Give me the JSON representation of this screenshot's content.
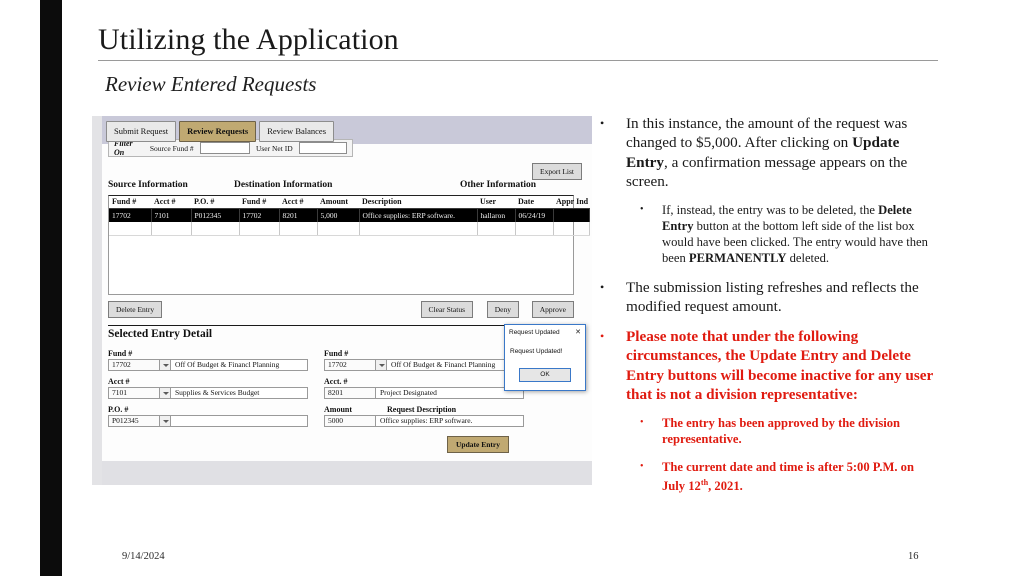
{
  "slide": {
    "title": "Utilizing the Application",
    "subtitle": "Review Entered Requests",
    "footer_date": "9/14/2024",
    "page_number": "16",
    "accent_color": "#c0a972",
    "alert_color": "#e01b10"
  },
  "app": {
    "tabs": [
      {
        "label": "Submit Request",
        "active": false
      },
      {
        "label": "Review Requests",
        "active": true
      },
      {
        "label": "Review Balances",
        "active": false
      }
    ],
    "filter": {
      "label": "Filter On",
      "source_fund_label": "Source Fund #",
      "source_fund_value": "",
      "user_net_id_label": "User Net ID",
      "user_net_id_value": ""
    },
    "export_button": "Export List",
    "section_headers": {
      "source": "Source Information",
      "destination": "Destination Information",
      "other": "Other Information"
    },
    "grid": {
      "columns": [
        "Fund #",
        "Acct #",
        "P.O. #",
        "Fund #",
        "Acct #",
        "Amount",
        "Description",
        "User",
        "Date",
        "Appr Ind"
      ],
      "rows": [
        [
          "17702",
          "7101",
          "P012345",
          "17702",
          "8201",
          "5,000",
          "Office supplies: ERP software.",
          "hallaron",
          "06/24/19",
          ""
        ]
      ],
      "blank_rows": 1
    },
    "list_buttons": {
      "delete": "Delete Entry",
      "clear_status": "Clear Status",
      "deny": "Deny",
      "approve": "Approve"
    },
    "detail": {
      "title": "Selected Entry Detail",
      "source": {
        "fund_label": "Fund #",
        "fund_code": "17702",
        "fund_name": "Off Of Budget & Financl Planning",
        "acct_label": "Acct #",
        "acct_code": "7101",
        "acct_name": "Supplies & Services Budget",
        "po_label": "P.O. #",
        "po_code": "P012345",
        "po_name": ""
      },
      "destination": {
        "fund_label": "Fund #",
        "fund_code": "17702",
        "fund_name": "Off Of Budget & Financl Planning",
        "acct_label": "Acct. #",
        "acct_code": "8201",
        "acct_name": "Project Designated",
        "amount_label": "Amount",
        "amount_value": "5000",
        "description_label": "Request Description",
        "description_value": "Office supplies: ERP software."
      },
      "update_button": "Update Entry"
    },
    "dialog": {
      "title": "Request Updated",
      "close_icon": "close-icon",
      "message": "Request Updated!",
      "ok_button": "OK"
    }
  },
  "bullets": [
    {
      "level": 1,
      "color": "black",
      "parts": [
        {
          "text": "In this instance, the amount of the request was changed to $5,000. After clicking on ",
          "bold": false
        },
        {
          "text": "Update Entry",
          "bold": true
        },
        {
          "text": ", a confirmation message appears on the screen.",
          "bold": false
        }
      ]
    },
    {
      "level": 2,
      "color": "black",
      "parts": [
        {
          "text": "If, instead, the entry was to be deleted, the ",
          "bold": false
        },
        {
          "text": "Delete Entry",
          "bold": true
        },
        {
          "text": " button at the bottom left side of the list box would have been clicked. The entry would have then been ",
          "bold": false
        },
        {
          "text": "PERMANENTLY",
          "bold": true
        },
        {
          "text": " deleted.",
          "bold": false
        }
      ]
    },
    {
      "level": 1,
      "color": "black",
      "parts": [
        {
          "text": "The submission listing refreshes and reflects the modified request amount.",
          "bold": false
        }
      ]
    },
    {
      "level": 1,
      "color": "red",
      "parts": [
        {
          "text": "Please note that under the following circumstances, the Update Entry and Delete Entry buttons will become inactive for any user that is not a division representative:",
          "bold": true
        }
      ]
    },
    {
      "level": 2,
      "color": "red",
      "parts": [
        {
          "text": "The entry has been approved by the division representative.",
          "bold": true
        }
      ]
    },
    {
      "level": 2,
      "color": "red",
      "parts": [
        {
          "text": "The current date and time is after 5:00 P.M. on July 12",
          "bold": true
        },
        {
          "text": "th",
          "bold": true,
          "sup": true
        },
        {
          "text": ", 2021.",
          "bold": true
        }
      ]
    }
  ]
}
